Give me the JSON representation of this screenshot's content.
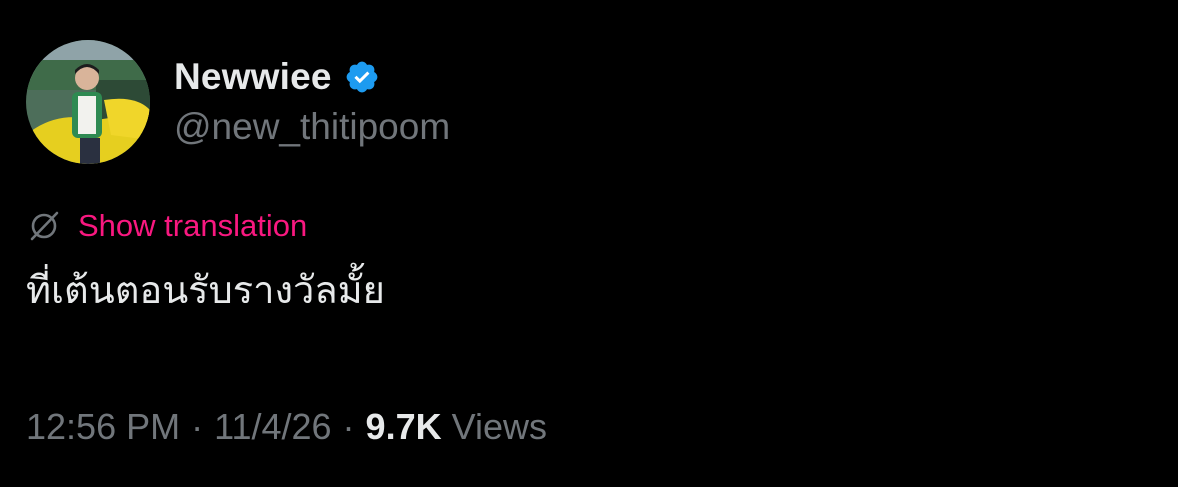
{
  "author": {
    "display_name": "Newwiee",
    "handle": "@new_thitipoom",
    "verified": true,
    "verified_color": "#1d9bf0"
  },
  "translation": {
    "link_label": "Show translation",
    "icon": "globe-slash-icon",
    "color": "#f91880"
  },
  "tweet": {
    "text": "ที่เต้นตอนรับรางวัลมั้ย"
  },
  "meta": {
    "time": "12:56 PM",
    "separator": "·",
    "date": "11/4/26",
    "views_count": "9.7K",
    "views_label": "Views"
  },
  "colors": {
    "background": "#000000",
    "primary_text": "#e7e9ea",
    "secondary_text": "#71767b",
    "accent_pink": "#f91880"
  }
}
